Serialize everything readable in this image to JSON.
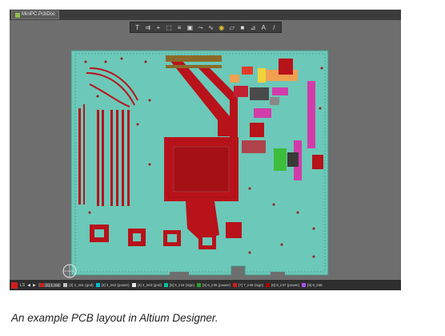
{
  "window": {
    "doc_tab_label": "MiniPC.PcbDoc",
    "doc_tab_icon": "pcb-doc-icon"
  },
  "toolbar": {
    "tools": [
      {
        "icon": "filter-icon",
        "glyph": "T"
      },
      {
        "icon": "route-icon",
        "glyph": "⇉"
      },
      {
        "icon": "cross-probe-icon",
        "glyph": "+"
      },
      {
        "icon": "select-rect-icon",
        "glyph": "⬚"
      },
      {
        "icon": "align-icon",
        "glyph": "≡"
      },
      {
        "icon": "component-icon",
        "glyph": "▣"
      },
      {
        "icon": "interactive-route-icon",
        "glyph": "⤳"
      },
      {
        "icon": "diff-pair-icon",
        "glyph": "∿"
      },
      {
        "icon": "via-icon",
        "glyph": "◉"
      },
      {
        "icon": "polygon-icon",
        "glyph": "▱"
      },
      {
        "icon": "fill-icon",
        "glyph": "■"
      },
      {
        "icon": "dimension-icon",
        "glyph": "⊿"
      },
      {
        "icon": "string-icon",
        "glyph": "A"
      },
      {
        "icon": "line-icon",
        "glyph": "/"
      }
    ]
  },
  "layers": {
    "nav_label": "LS",
    "active": "[1] 1_top",
    "items": [
      {
        "label": "[1] 1_top",
        "color": "#d41c1c"
      },
      {
        "label": "[2] 2_int1 (gnd)",
        "color": "#c0c0c0"
      },
      {
        "label": "[3] 3_int2 (power)",
        "color": "#00bcd4"
      },
      {
        "label": "[4] 4_int3 (gnd)",
        "color": "#e8e8e8"
      },
      {
        "label": "[5] 5_int4 (sign)",
        "color": "#00bfa0"
      },
      {
        "label": "[6] 6_int5 (power)",
        "color": "#2ba02b"
      },
      {
        "label": "[7] 7_int6 (sign)",
        "color": "#d41c1c"
      },
      {
        "label": "[8] 8_int7 (power)",
        "color": "#b00000"
      },
      {
        "label": "[9] 9_int8",
        "color": "#b050ff"
      }
    ]
  },
  "colors": {
    "board": "#6cc8b8",
    "trace": "#b8121a",
    "pad_magenta": "#d23caa",
    "pad_orange": "#f0a050",
    "pad_yellow": "#f0d23c",
    "pad_green": "#3cbe3c",
    "background": "#6e6e6e"
  },
  "caption": "An example PCB layout in Altium Designer."
}
